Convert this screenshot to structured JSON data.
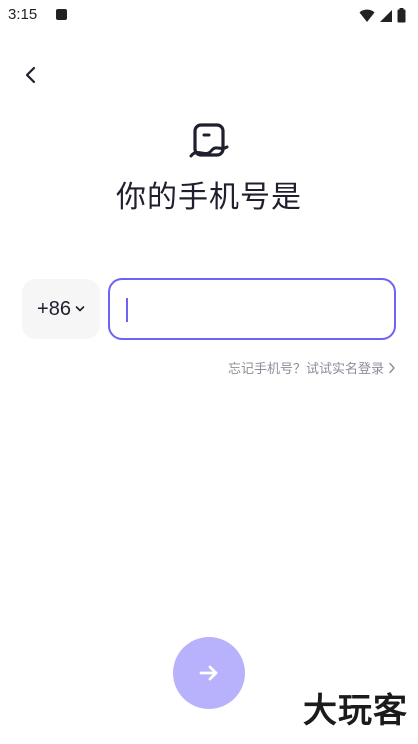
{
  "status_bar": {
    "time": "3:15"
  },
  "title": "你的手机号是",
  "country_code": "+86",
  "phone_input": {
    "value": "",
    "placeholder": ""
  },
  "forgot_link": "忘记手机号？试试实名登录",
  "watermark": "大玩客",
  "colors": {
    "accent": "#6f63f6",
    "next_button_bg": "#b7b2fb",
    "country_code_bg": "#f6f6f7",
    "link_gray": "#8d8d99"
  },
  "icons": {
    "back": "chevron-left-icon",
    "dropdown": "chevron-down-icon",
    "link_arrow": "chevron-right-icon",
    "next": "arrow-right-icon"
  }
}
